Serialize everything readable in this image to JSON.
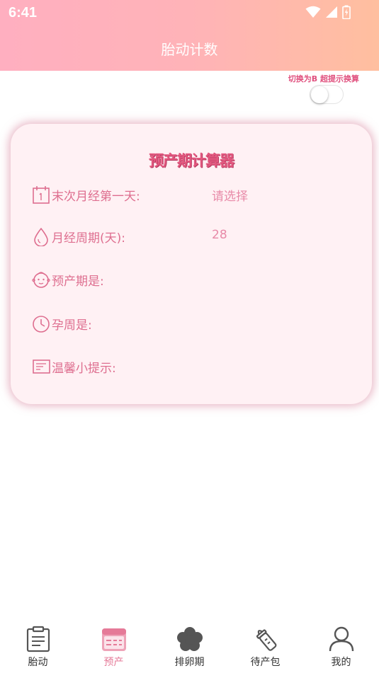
{
  "status_bar": {
    "time": "6:41",
    "icons": [
      "wifi-icon",
      "signal-icon",
      "battery-icon"
    ]
  },
  "header": {
    "title": "胎动计数"
  },
  "switch": {
    "label": "切换为B 超提示换算",
    "on": false
  },
  "calculator": {
    "title": "预产期计算器",
    "rows": [
      {
        "icon": "calendar-icon",
        "label": "末次月经第一天:",
        "value": "请选择"
      },
      {
        "icon": "drop-icon",
        "label": "月经周期(天):",
        "value": "28"
      },
      {
        "icon": "baby-face-icon",
        "label": "预产期是:",
        "value": ""
      },
      {
        "icon": "clock-icon",
        "label": "孕周是:",
        "value": ""
      },
      {
        "icon": "note-icon",
        "label": "温馨小提示:",
        "value": ""
      }
    ]
  },
  "tabbar": {
    "active_index": 1,
    "tabs": [
      {
        "label": "胎动",
        "icon": "clipboard-icon"
      },
      {
        "label": "预产",
        "icon": "calendar-icon"
      },
      {
        "label": "排卵期",
        "icon": "flower-icon"
      },
      {
        "label": "待产包",
        "icon": "baby-bottle-icon"
      },
      {
        "label": "我的",
        "icon": "person-icon"
      }
    ]
  },
  "colors": {
    "header_gradient_start": "#ffafc0",
    "header_gradient_end": "#ffbf9f",
    "accent_pink": "#e2577e",
    "card_background": "#fff1f4",
    "active_tab": "#e57a98"
  }
}
